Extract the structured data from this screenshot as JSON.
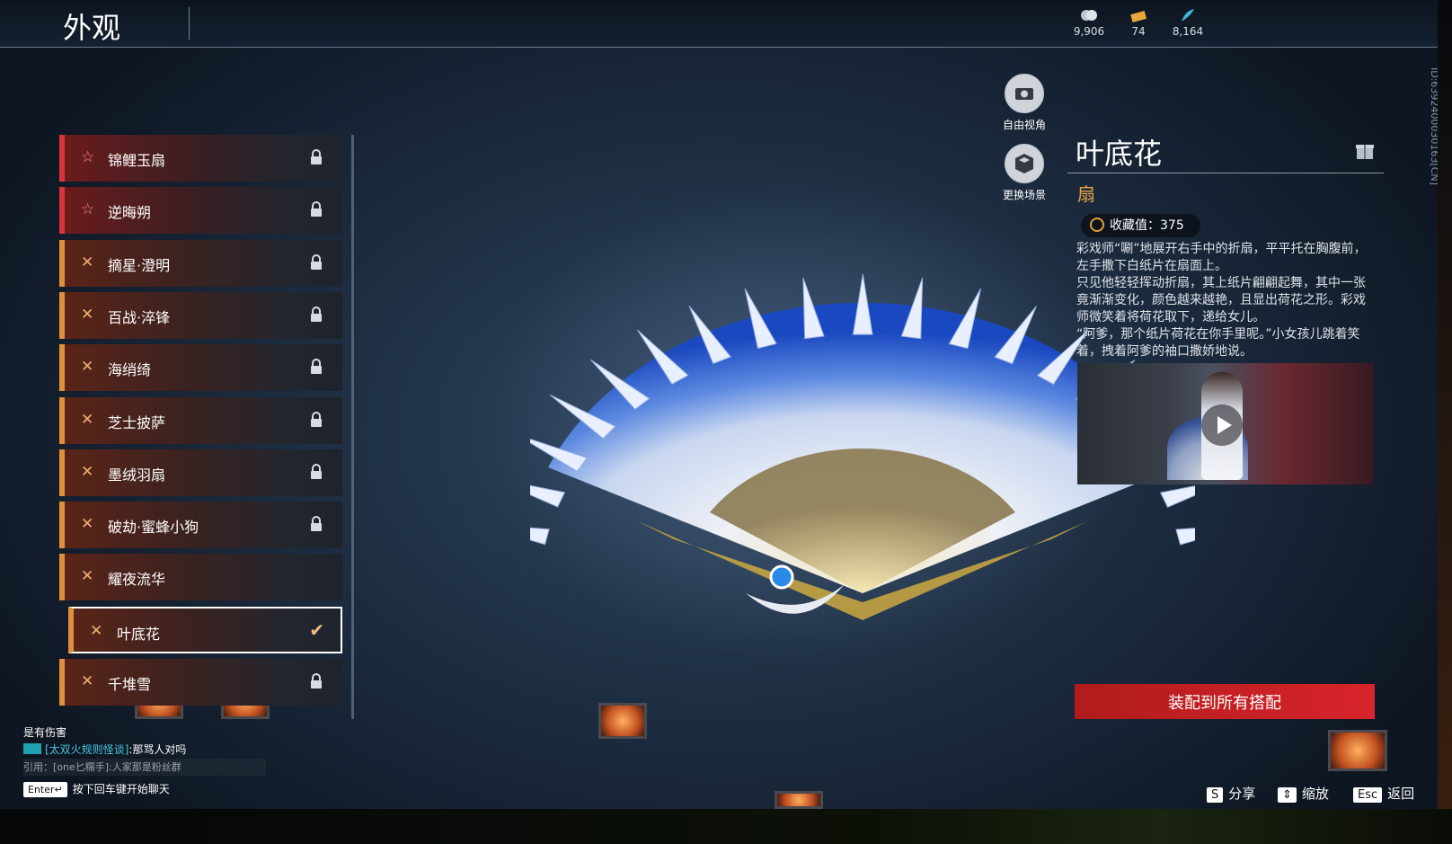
{
  "header": {
    "title": "外观",
    "currencies": [
      {
        "icon": "silver-coin-icon",
        "value": "9,906"
      },
      {
        "icon": "ticket-icon",
        "value": "74"
      },
      {
        "icon": "feather-icon",
        "value": "8,164"
      }
    ]
  },
  "view_controls": {
    "free_camera": "自由视角",
    "change_scene": "更换场景"
  },
  "list": [
    {
      "name": "锦鲤玉扇",
      "rarity": "red",
      "locked": true
    },
    {
      "name": "逆晦朔",
      "rarity": "red",
      "locked": true
    },
    {
      "name": "摘星·澄明",
      "rarity": "orange",
      "locked": true
    },
    {
      "name": "百战·淬锋",
      "rarity": "orange",
      "locked": true
    },
    {
      "name": "海绡绮",
      "rarity": "orange",
      "locked": true
    },
    {
      "name": "芝士披萨",
      "rarity": "orange",
      "locked": true
    },
    {
      "name": "墨绒羽扇",
      "rarity": "orange",
      "locked": true
    },
    {
      "name": "破劫·蜜蜂小狗",
      "rarity": "orange",
      "locked": true
    },
    {
      "name": "耀夜流华",
      "rarity": "orange",
      "locked": false
    },
    {
      "name": "叶底花",
      "rarity": "orange",
      "locked": false,
      "selected": true
    },
    {
      "name": "千堆雪",
      "rarity": "orange",
      "locked": true
    }
  ],
  "detail": {
    "name": "叶底花",
    "type": "扇",
    "collection_label": "收藏值：375",
    "description": [
      "彩戏师“唰”地展开右手中的折扇，平平托在胸腹前，左手撒下白纸片在扇面上。",
      "只见他轻轻挥动折扇，其上纸片翩翩起舞，其中一张竟渐渐变化，颜色越来越艳，且显出荷花之形。彩戏师微笑着将荷花取下，递给女儿。",
      "“阿爹，那个纸片荷花在你手里呢。”小女孩儿跳着笑着，拽着阿爹的袖口撒娇地说。"
    ],
    "equip_button": "装配到所有搭配",
    "id_text": "ID:6392400030163[CN]"
  },
  "chat": {
    "line1": "是有伤害",
    "line2_channel": "[太双火规则怪谈]",
    "line2_text": ":那骂人对吗",
    "line3": "引用：[one匕糯手]:人家那是粉丝群",
    "hint_key": "Enter↵",
    "hint_text": "按下回车键开始聊天"
  },
  "shortcuts": {
    "share_key": "S",
    "share": "分享",
    "zoom": "缩放",
    "back_key": "Esc",
    "back": "返回"
  },
  "colors": {
    "accent_red": "#d8242a",
    "rarity_orange": "#e0903a",
    "rarity_red": "#d8343c",
    "type_gold": "#e8a444"
  }
}
